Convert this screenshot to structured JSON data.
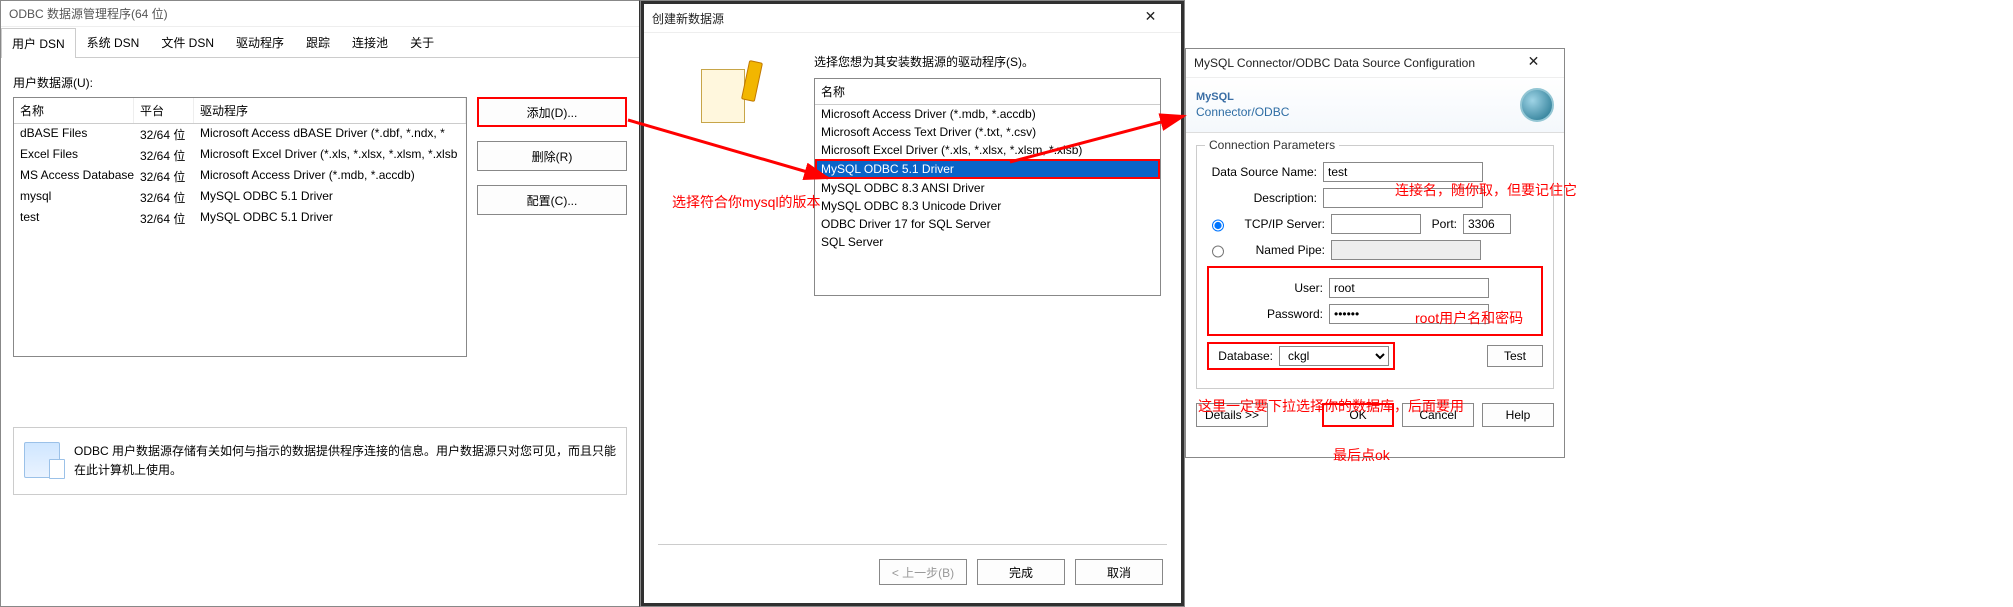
{
  "w1": {
    "title": "ODBC 数据源管理程序(64 位)",
    "tabs": [
      "用户 DSN",
      "系统 DSN",
      "文件 DSN",
      "驱动程序",
      "跟踪",
      "连接池",
      "关于"
    ],
    "label_top": "用户数据源(U):",
    "cols": {
      "name": "名称",
      "platform": "平台",
      "driver": "驱动程序"
    },
    "rows": [
      {
        "name": "dBASE Files",
        "platform": "32/64 位",
        "driver": "Microsoft Access dBASE Driver (*.dbf, *.ndx, *"
      },
      {
        "name": "Excel Files",
        "platform": "32/64 位",
        "driver": "Microsoft Excel Driver (*.xls, *.xlsx, *.xlsm, *.xlsb"
      },
      {
        "name": "MS Access Database",
        "platform": "32/64 位",
        "driver": "Microsoft Access Driver (*.mdb, *.accdb)"
      },
      {
        "name": "mysql",
        "platform": "32/64 位",
        "driver": "MySQL ODBC 5.1 Driver"
      },
      {
        "name": "test",
        "platform": "32/64 位",
        "driver": "MySQL ODBC 5.1 Driver"
      }
    ],
    "btn_add": "添加(D)...",
    "btn_del": "删除(R)",
    "btn_cfg": "配置(C)...",
    "info": "ODBC 用户数据源存储有关如何与指示的数据提供程序连接的信息。用户数据源只对您可见，而且只能在此计算机上使用。"
  },
  "w2": {
    "title": "创建新数据源",
    "prompt": "选择您想为其安装数据源的驱动程序(S)。",
    "col_name": "名称",
    "drivers": [
      "Microsoft Access Driver (*.mdb, *.accdb)",
      "Microsoft Access Text Driver (*.txt, *.csv)",
      "Microsoft Excel Driver (*.xls, *.xlsx, *.xlsm, *.xlsb)",
      "MySQL ODBC 5.1 Driver",
      "MySQL ODBC 8.3 ANSI Driver",
      "MySQL ODBC 8.3 Unicode Driver",
      "ODBC Driver 17 for SQL Server",
      "SQL Server"
    ],
    "selected_index": 3,
    "btn_back": "< 上一步(B)",
    "btn_finish": "完成",
    "btn_cancel": "取消"
  },
  "w3": {
    "title": "MySQL Connector/ODBC Data Source Configuration",
    "brand_top": "MySQL",
    "brand_bottom": "Connector/ODBC",
    "group_title": "Connection Parameters",
    "lbl_dsn": "Data Source Name:",
    "val_dsn": "test",
    "lbl_desc": "Description:",
    "val_desc": "",
    "lbl_tcp": "TCP/IP Server:",
    "val_tcp": "",
    "lbl_port": "Port:",
    "val_port": "3306",
    "lbl_pipe": "Named Pipe:",
    "lbl_user": "User:",
    "val_user": "root",
    "lbl_pwd": "Password:",
    "val_pwd": "••••••",
    "lbl_db": "Database:",
    "val_db": "ckgl",
    "btn_test": "Test",
    "btn_details": "Details >>",
    "btn_ok": "OK",
    "btn_cancel": "Cancel",
    "btn_help": "Help"
  },
  "ann": {
    "a1": "选择符合你mysql的版本",
    "a2": "连接名，随你取，但要记住它",
    "a3": "root用户名和密码",
    "a4": "这里一定要下拉选择你的数据库，后面要用",
    "a5": "最后点ok"
  }
}
